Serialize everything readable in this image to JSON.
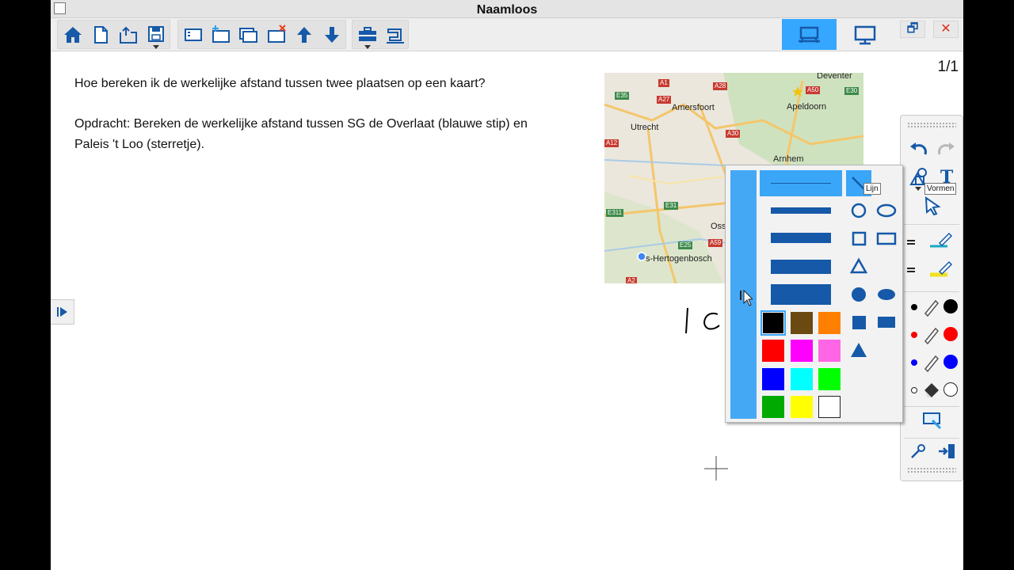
{
  "window": {
    "title": "Naamloos"
  },
  "toolbar": {
    "icons": [
      "home-icon",
      "new-page-icon",
      "open-icon",
      "save-icon",
      "page-list-icon",
      "add-page-icon",
      "duplicate-page-icon",
      "delete-page-icon",
      "page-up-icon",
      "page-down-icon",
      "toolbox-icon",
      "sewing-machine-icon"
    ],
    "view_icons": [
      "board-view-icon",
      "monitor-view-icon"
    ],
    "restore_symbol": "🗗",
    "close_symbol": "✕"
  },
  "page": {
    "number": "1/1",
    "question": "Hoe bereken ik de werkelijke afstand tussen twee plaatsen op een kaart?",
    "assignment_line1": "Opdracht: Bereken de werkelijke afstand tussen SG de Overlaat (blauwe stip) en",
    "assignment_line2": "Paleis 't Loo (sterretje)."
  },
  "map": {
    "cities": {
      "deventer": "Deventer",
      "amersfoort": "Amersfoort",
      "apeldoorn": "Apeldoorn",
      "utrecht": "Utrecht",
      "arnhem": "Arnhem",
      "oss": "Oss",
      "den_bosch": "s-Hertogenbosch"
    },
    "roads": {
      "a1": "A1",
      "a28": "A28",
      "a50": "A50",
      "e30": "E30",
      "e35": "E35",
      "a27": "A27",
      "a30": "A30",
      "a12": "A12",
      "e311": "E311",
      "e31": "E31",
      "e25": "E25",
      "a59": "A59",
      "a2": "A2"
    }
  },
  "shapes_popup": {
    "line_widths": [
      1,
      3,
      5,
      6,
      8
    ],
    "colors": [
      "#000000",
      "#6b4a12",
      "#ff8000",
      "#ff0000",
      "#ff00ff",
      "#ff66e5",
      "#0000ff",
      "#00ffff",
      "#00ff00",
      "#00aa00",
      "#ffff00",
      "#ffffff"
    ],
    "shapes": [
      "line-icon",
      "circle-outline-icon",
      "ellipse-outline-icon",
      "square-outline-icon",
      "rectangle-outline-icon",
      "triangle-outline-icon",
      "circle-filled-icon",
      "ellipse-filled-icon",
      "square-filled-icon",
      "rectangle-filled-icon",
      "triangle-filled-icon"
    ],
    "shape_color": "#1559a8"
  },
  "tooltips": {
    "line": "Lijn",
    "shapes": "Vormen"
  },
  "toolpanel": {
    "text_tool": "T",
    "pen_colors": [
      "#000000",
      "#ff0000",
      "#0000ff"
    ],
    "highlighter_colors": [
      "#1aa8c4",
      "#f0e020"
    ]
  },
  "colors": {
    "accent": "#35a7ff",
    "icon_blue": "#1559a8"
  }
}
